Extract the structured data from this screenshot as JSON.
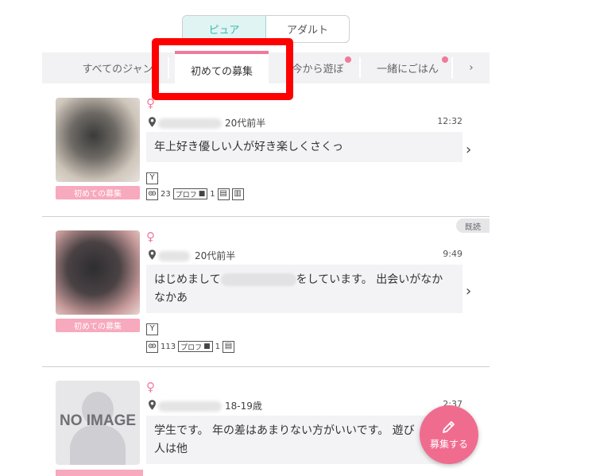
{
  "mode_toggle": {
    "options": [
      "ピュア",
      "アダルト"
    ],
    "active": "ピュア"
  },
  "categories": {
    "items": [
      "すべてのジャン",
      "初めての募集",
      "今から遊ぼ",
      "一緒にごはん"
    ],
    "active": "初めての募集",
    "more": "›"
  },
  "posts": [
    {
      "age": "20代前半",
      "time": "12:32",
      "message": "年上好き優しい人が好き楽しくさくっ",
      "badge": "初めての募集",
      "views": "23",
      "prof_label": "プロフ",
      "photo_count": "1",
      "read": false
    },
    {
      "age": "20代前半",
      "time": "9:49",
      "message_part1": "はじめまして",
      "message_part2": "をしています。 出会いがなか",
      "message_line2": "なかあ",
      "badge": "初めての募集",
      "views": "113",
      "prof_label": "プロフ",
      "photo_count": "1",
      "read": true,
      "read_label": "既読"
    },
    {
      "age": "18-19歳",
      "time": "2:37",
      "message_line1": "学生です。 年の差はあまりない方がいいです。 遊び",
      "message_line2": "人は他",
      "noimage_text": "NO IMAGE"
    }
  ],
  "gender_symbol": "♀",
  "fab": {
    "label": "募集する",
    "icon": "pencil-icon"
  },
  "colors": {
    "accent_pink": "#f06c8f",
    "teal": "#3bb8b1",
    "highlight_red": "#ff0000"
  }
}
